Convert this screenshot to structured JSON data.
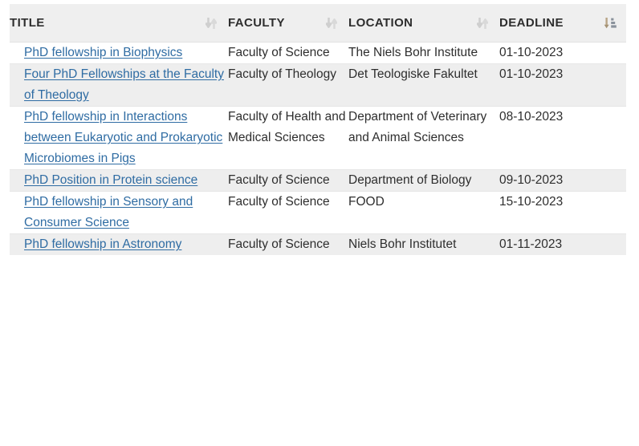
{
  "table": {
    "columns": [
      {
        "label": "TITLE",
        "sort_icon": "sort-both-icon",
        "sort_state": "none"
      },
      {
        "label": "FACULTY",
        "sort_icon": "sort-both-icon",
        "sort_state": "none"
      },
      {
        "label": "LOCATION",
        "sort_icon": "sort-both-icon",
        "sort_state": "none"
      },
      {
        "label": "DEADLINE",
        "sort_icon": "sort-ascending-icon",
        "sort_state": "ascending"
      }
    ],
    "rows": [
      {
        "title": "PhD fellowship in Biophysics",
        "faculty": "Faculty of Science",
        "location": "The Niels Bohr Institute",
        "deadline": "01-10-2023"
      },
      {
        "title": "Four PhD Fellowships at the Faculty of Theology",
        "faculty": "Faculty of Theology",
        "location": "Det Teologiske Fakultet",
        "deadline": "01-10-2023"
      },
      {
        "title": "PhD fellowship in Interactions between Eukaryotic and Prokaryotic Microbiomes in Pigs",
        "faculty": "Faculty of Health and Medical Sciences",
        "location": "Department of Veterinary and Animal Sciences",
        "deadline": "08-10-2023"
      },
      {
        "title": "PhD Position in Protein science",
        "faculty": "Faculty of Science",
        "location": "Department of Biology",
        "deadline": "09-10-2023"
      },
      {
        "title": "PhD fellowship in Sensory and Consumer Science",
        "faculty": "Faculty of Science",
        "location": "FOOD",
        "deadline": "15-10-2023"
      },
      {
        "title": "PhD fellowship in Astronomy",
        "faculty": "Faculty of Science",
        "location": "Niels Bohr Institutet",
        "deadline": "01-11-2023"
      }
    ]
  },
  "colors": {
    "link": "#2f6ca3",
    "text": "#2e2e2e",
    "header_bg": "#efefef",
    "stripe_bg": "#eeeeee",
    "row_border": "#e6e6e6",
    "sort_icon_inactive": "#cfcfcf",
    "sort_icon_active_arrow": "#b59a6a",
    "sort_icon_active_bars": "#8a929c"
  }
}
